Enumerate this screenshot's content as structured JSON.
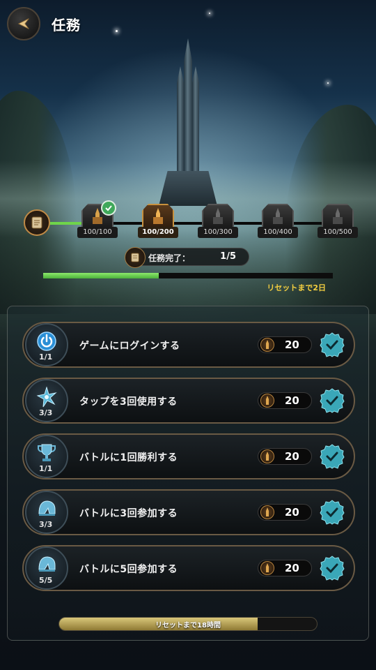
{
  "header": {
    "title": "任務"
  },
  "milestones": [
    {
      "value": "100/100",
      "state": "claimed"
    },
    {
      "value": "100/200",
      "state": "active"
    },
    {
      "value": "100/300",
      "state": "locked"
    },
    {
      "value": "100/400",
      "state": "locked"
    },
    {
      "value": "100/500",
      "state": "locked"
    }
  ],
  "completion": {
    "label": "任務完了：",
    "count": "1/5",
    "progress_fraction": 0.4
  },
  "daily_reset_text": "リセットまで2日",
  "tasks": [
    {
      "icon": "power-icon",
      "progress": "1/1",
      "name": "ゲームにログインする",
      "reward": "20",
      "completed": true
    },
    {
      "icon": "star-icon",
      "progress": "3/3",
      "name": "タップを3回使用する",
      "reward": "20",
      "completed": true
    },
    {
      "icon": "trophy-icon",
      "progress": "1/1",
      "name": "バトルに1回勝利する",
      "reward": "20",
      "completed": true
    },
    {
      "icon": "helmet-icon",
      "progress": "3/3",
      "name": "バトルに3回参加する",
      "reward": "20",
      "completed": true
    },
    {
      "icon": "helmet-icon",
      "progress": "5/5",
      "name": "バトルに5回参加する",
      "reward": "20",
      "completed": true
    }
  ],
  "bottom_timer": {
    "text": "リセットまで18時間",
    "progress_fraction": 0.77
  },
  "colors": {
    "progress_green": "#6fd44a",
    "timer_gold": "#f5cf40",
    "check_teal": "#3aa7b8"
  }
}
